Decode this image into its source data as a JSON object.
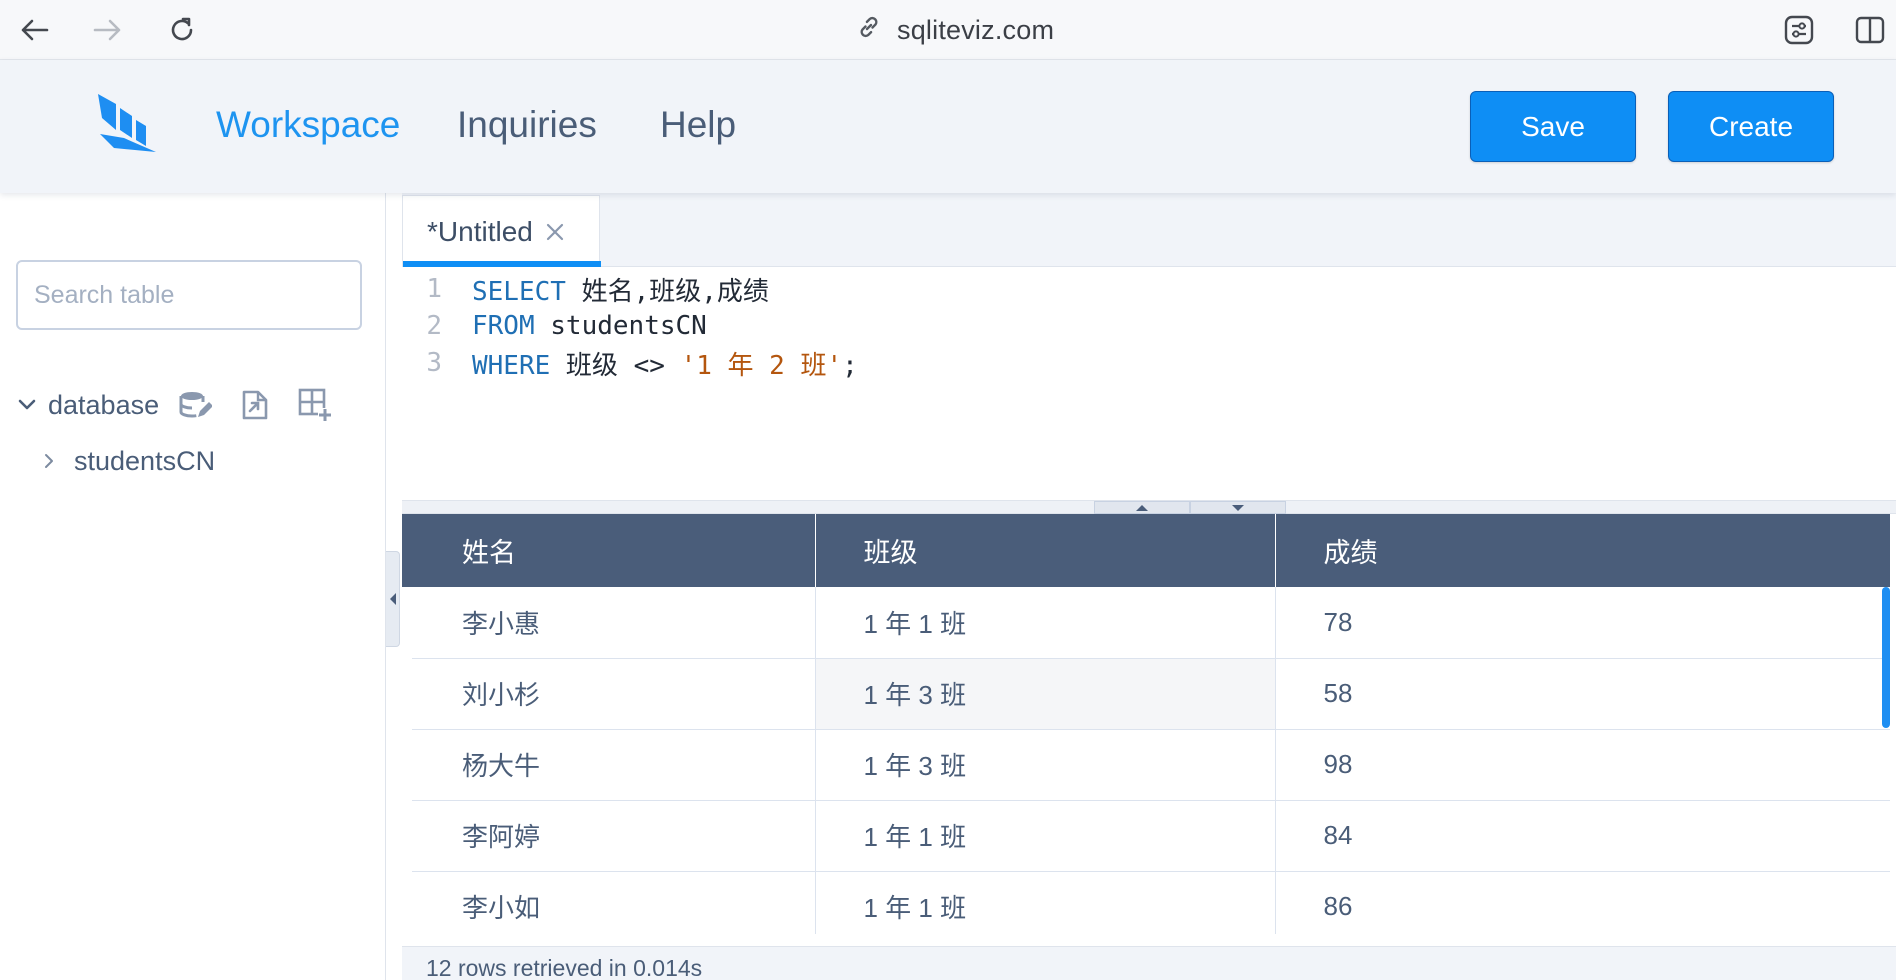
{
  "browser": {
    "url": "sqliteviz.com"
  },
  "header": {
    "nav": [
      {
        "label": "Workspace",
        "active": true
      },
      {
        "label": "Inquiries",
        "active": false
      },
      {
        "label": "Help",
        "active": false
      }
    ],
    "save_label": "Save",
    "create_label": "Create",
    "accent_color": "#0e8ef5"
  },
  "sidebar": {
    "search_placeholder": "Search table",
    "database_label": "database",
    "tables": [
      "studentsCN"
    ]
  },
  "editor": {
    "tab_title": "*Untitled",
    "lines": [
      {
        "no": "1",
        "kw": "SELECT",
        "rest": " 姓名,班级,成绩",
        "str": "",
        "tail": ""
      },
      {
        "no": "2",
        "kw": "FROM",
        "rest": " studentsCN",
        "str": "",
        "tail": ""
      },
      {
        "no": "3",
        "kw": "WHERE",
        "rest": " 班级 <> ",
        "str": "'1 年 2 班'",
        "tail": ";"
      }
    ]
  },
  "results": {
    "columns": [
      "姓名",
      "班级",
      "成绩"
    ],
    "rows": [
      [
        "李小惠",
        "1 年 1 班",
        "78"
      ],
      [
        "刘小杉",
        "1 年 3 班",
        "58"
      ],
      [
        "杨大牛",
        "1 年 3 班",
        "98"
      ],
      [
        "李阿婷",
        "1 年 1 班",
        "84"
      ],
      [
        "李小如",
        "1 年 1 班",
        "86"
      ]
    ],
    "status": "12 rows retrieved in 0.014s"
  }
}
